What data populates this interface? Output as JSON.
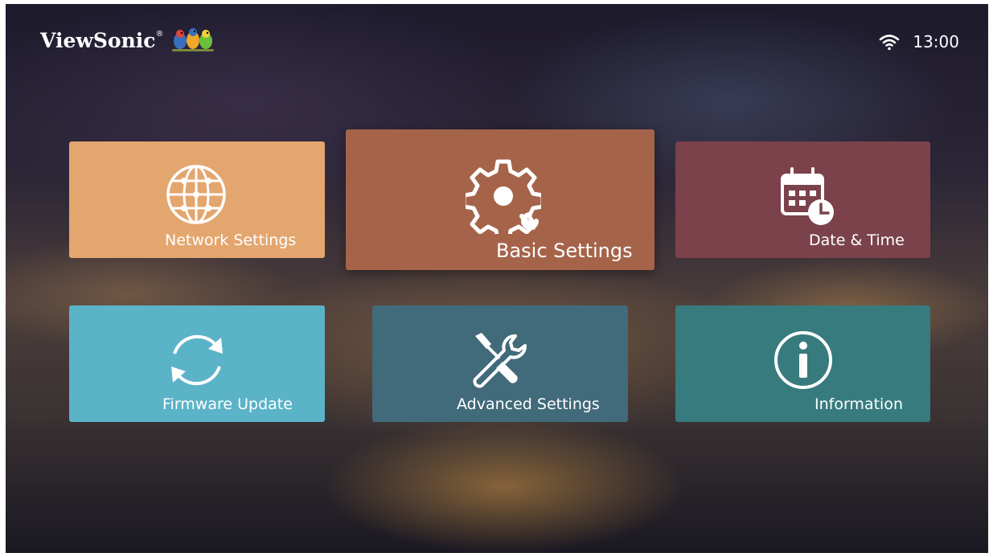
{
  "header": {
    "brand": "ViewSonic",
    "brand_mark": "®",
    "logo_icon": "birds-logo-icon",
    "wifi_icon": "wifi-icon",
    "time": "13:00"
  },
  "menu": {
    "tiles": [
      {
        "label": "Network Settings",
        "icon": "globe-icon",
        "color": "#e4a66f"
      },
      {
        "label": "Basic Settings",
        "icon": "gear-icon",
        "color": "#a5644a",
        "selected": true
      },
      {
        "label": "Date & Time",
        "icon": "calendar-clock-icon",
        "color": "#7b424c"
      },
      {
        "label": "Firmware Update",
        "icon": "refresh-icon",
        "color": "#5bb3c8"
      },
      {
        "label": "Advanced Settings",
        "icon": "tools-icon",
        "color": "#416a7a"
      },
      {
        "label": "Information",
        "icon": "info-icon",
        "color": "#377b7e"
      }
    ]
  }
}
